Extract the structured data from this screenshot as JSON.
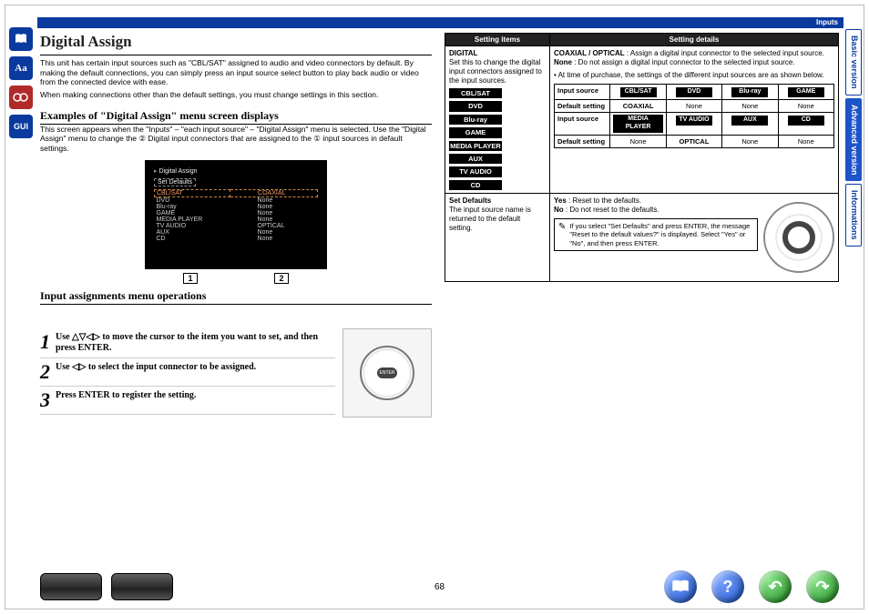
{
  "header": {
    "crumb": "Inputs",
    "page_number": "68"
  },
  "side_tabs": {
    "basic": "Basic version",
    "advanced": "Advanced version",
    "informations": "Informations"
  },
  "left_icons": {
    "aa": "Aa",
    "gui": "GUI"
  },
  "left": {
    "title": "Digital Assign",
    "intro1": "This unit has certain input sources such as \"CBL/SAT\" assigned to audio and video connectors by default. By making the default connections, you can simply press an input source select button to play back audio or video from the connected device with ease.",
    "intro2": "When making connections other than the default settings, you must change settings in this section.",
    "sub1": "Examples of \"Digital Assign\" menu screen displays",
    "sub1_para": "This screen appears when the \"Inputs\" – \"each input source\" – \"Digital Assign\" menu is selected. Use the \"Digital Assign\" menu to change the ② Digital input connectors that are assigned to the ① input sources in default settings.",
    "osd": {
      "title": "Digital Assign",
      "set_defaults": "Set Defaults",
      "rows": [
        {
          "l": "CBL/SAT",
          "r": "COAXIAL",
          "sel": true
        },
        {
          "l": "DVD",
          "r": "None"
        },
        {
          "l": "Blu-ray",
          "r": "None"
        },
        {
          "l": "GAME",
          "r": "None"
        },
        {
          "l": "MEDIA PLAYER",
          "r": "None"
        },
        {
          "l": "TV AUDIO",
          "r": "OPTICAL"
        },
        {
          "l": "AUX",
          "r": "None"
        },
        {
          "l": "CD",
          "r": "None"
        }
      ],
      "label1": "1",
      "label2": "2"
    },
    "sub2": "Input assignments menu operations",
    "steps": [
      {
        "n": "1",
        "t": "Use △▽◁▷ to move the cursor to the item you want to set, and then press ENTER."
      },
      {
        "n": "2",
        "t": "Use ◁▷ to select the input connector to be assigned."
      },
      {
        "n": "3",
        "t": "Press ENTER to register the setting."
      }
    ]
  },
  "right": {
    "th1": "Setting items",
    "th2": "Setting details",
    "digital": {
      "name": "DIGITAL",
      "desc": "Set this to change the digital input connectors assigned to the input sources.",
      "details1a": "COAXIAL / OPTICAL",
      "details1b": " : Assign a digital input connector to the selected input source.",
      "details2a": "None",
      "details2b": " : Do not assign a digital input connector to the selected input source.",
      "bullet": "• At time of purchase, the settings of the different input sources are as shown below.",
      "pills": [
        "CBL/SAT",
        "DVD",
        "Blu-ray",
        "GAME",
        "MEDIA PLAYER",
        "AUX",
        "TV AUDIO",
        "CD"
      ],
      "io": {
        "row1h": "Input source",
        "row1": [
          "CBL/SAT",
          "DVD",
          "Blu-ray",
          "GAME"
        ],
        "row2h": "Default setting",
        "row2": [
          "COAXIAL",
          "None",
          "None",
          "None"
        ],
        "row3h": "Input source",
        "row3": [
          "MEDIA PLAYER",
          "TV AUDIO",
          "AUX",
          "CD"
        ],
        "row4h": "Default setting",
        "row4": [
          "None",
          "OPTICAL",
          "None",
          "None"
        ]
      }
    },
    "set_defaults": {
      "name": "Set Defaults",
      "desc": "The input source name is returned to the default setting.",
      "yes": "Yes",
      "yes2": " : Reset to the defaults.",
      "no": "No",
      "no2": " : Do not reset to the defaults.",
      "note": "If you select \"Set Defaults\" and press ENTER, the message \"Reset to the default values?\" is displayed. Select \"Yes\" or \"No\", and then press ENTER."
    }
  }
}
